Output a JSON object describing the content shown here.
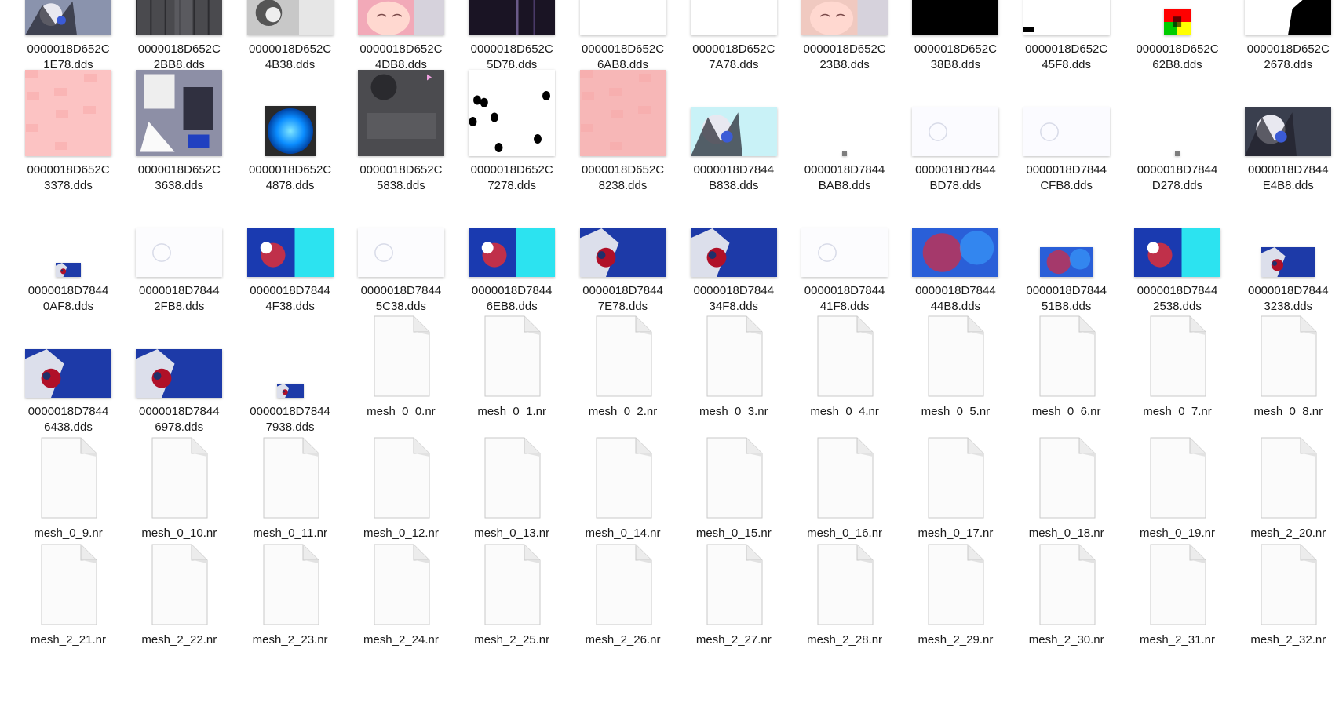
{
  "window_title": "",
  "files": [
    {
      "name": "0000018D652C\n1E78.dds",
      "kind": "image",
      "icon": "thumbnail-character-render",
      "thumb": {
        "w": 110,
        "h": 48,
        "bg": "#8a93ad",
        "pattern": "tex-char-dark"
      }
    },
    {
      "name": "0000018D652C\n2BB8.dds",
      "kind": "image",
      "icon": "thumbnail-dark-cloth-texture",
      "thumb": {
        "w": 110,
        "h": 48,
        "bg": "#4a4a4e",
        "pattern": "tex-dark-folds"
      }
    },
    {
      "name": "0000018D652C\n4B38.dds",
      "kind": "image",
      "icon": "thumbnail-grey-detail-texture",
      "thumb": {
        "w": 110,
        "h": 48,
        "bg": "#c8c8c8",
        "pattern": "tex-grey-detail"
      }
    },
    {
      "name": "0000018D652C\n4DB8.dds",
      "kind": "image",
      "icon": "thumbnail-pink-face-texture",
      "thumb": {
        "w": 110,
        "h": 48,
        "bg": "#f2a9b8",
        "pattern": "tex-face"
      }
    },
    {
      "name": "0000018D652C\n5D78.dds",
      "kind": "image",
      "icon": "thumbnail-dark-purple-texture",
      "thumb": {
        "w": 110,
        "h": 48,
        "bg": "#1a1424",
        "pattern": "tex-dark-purple"
      }
    },
    {
      "name": "0000018D652C\n6AB8.dds",
      "kind": "image",
      "icon": "thumbnail-blank-white",
      "thumb": {
        "w": 110,
        "h": 48,
        "bg": "#ffffff",
        "pattern": "none"
      }
    },
    {
      "name": "0000018D652C\n7A78.dds",
      "kind": "image",
      "icon": "thumbnail-blank-white",
      "thumb": {
        "w": 110,
        "h": 48,
        "bg": "#ffffff",
        "pattern": "none"
      }
    },
    {
      "name": "0000018D652C\n23B8.dds",
      "kind": "image",
      "icon": "thumbnail-chibi-face",
      "thumb": {
        "w": 110,
        "h": 48,
        "bg": "#f0c9c0",
        "pattern": "tex-face"
      }
    },
    {
      "name": "0000018D652C\n38B8.dds",
      "kind": "image",
      "icon": "thumbnail-black",
      "thumb": {
        "w": 110,
        "h": 48,
        "bg": "#000000",
        "pattern": "none"
      }
    },
    {
      "name": "0000018D652C\n45F8.dds",
      "kind": "image",
      "icon": "thumbnail-white-with-mark",
      "thumb": {
        "w": 110,
        "h": 48,
        "bg": "#ffffff",
        "pattern": "tex-corner-mark"
      }
    },
    {
      "name": "0000018D652C\n62B8.dds",
      "kind": "image",
      "icon": "thumbnail-rgb-gradient",
      "thumb": {
        "w": 34,
        "h": 34,
        "bg": "#000000",
        "pattern": "tex-rgb"
      }
    },
    {
      "name": "0000018D652C\n2678.dds",
      "kind": "image",
      "icon": "thumbnail-black-silhouette",
      "thumb": {
        "w": 110,
        "h": 48,
        "bg": "#ffffff",
        "pattern": "tex-silhouette"
      }
    },
    {
      "name": "0000018D652C\n3378.dds",
      "kind": "image",
      "icon": "thumbnail-pink-texture",
      "thumb": {
        "w": 110,
        "h": 110,
        "bg": "#fcc3c3",
        "pattern": "tex-pink-emboss"
      }
    },
    {
      "name": "0000018D652C\n3638.dds",
      "kind": "image",
      "icon": "thumbnail-armor-texture",
      "thumb": {
        "w": 110,
        "h": 110,
        "bg": "#8d8fa6",
        "pattern": "tex-armor"
      }
    },
    {
      "name": "0000018D652C\n4878.dds",
      "kind": "image",
      "icon": "thumbnail-blue-sphere",
      "thumb": {
        "w": 64,
        "h": 64,
        "bg": "#2a2a2a",
        "pattern": "tex-sphere"
      }
    },
    {
      "name": "0000018D652C\n5838.dds",
      "kind": "image",
      "icon": "thumbnail-dark-grey-texture",
      "thumb": {
        "w": 110,
        "h": 110,
        "bg": "#4b4b4f",
        "pattern": "tex-dark-grey"
      }
    },
    {
      "name": "0000018D652C\n7278.dds",
      "kind": "image",
      "icon": "thumbnail-white-black-spots",
      "thumb": {
        "w": 110,
        "h": 110,
        "bg": "#ffffff",
        "pattern": "tex-spots"
      }
    },
    {
      "name": "0000018D652C\n8238.dds",
      "kind": "image",
      "icon": "thumbnail-pink-emboss",
      "thumb": {
        "w": 110,
        "h": 110,
        "bg": "#f7b7b7",
        "pattern": "tex-pink-emboss"
      }
    },
    {
      "name": "0000018D7844\nB838.dds",
      "kind": "image",
      "icon": "thumbnail-character-on-cyan",
      "thumb": {
        "w": 110,
        "h": 62,
        "bg": "#c9f2f7",
        "pattern": "tex-char-dark"
      }
    },
    {
      "name": "0000018D7844\nBAB8.dds",
      "kind": "image",
      "icon": "thumbnail-tiny-dot",
      "thumb": {
        "w": 6,
        "h": 6,
        "bg": "#7d7d7d",
        "pattern": "none"
      }
    },
    {
      "name": "0000018D7844\nBD78.dds",
      "kind": "image",
      "icon": "thumbnail-faint-white",
      "thumb": {
        "w": 110,
        "h": 62,
        "bg": "#fbfbff",
        "pattern": "tex-faint"
      }
    },
    {
      "name": "0000018D7844\nCFB8.dds",
      "kind": "image",
      "icon": "thumbnail-faint-white",
      "thumb": {
        "w": 110,
        "h": 62,
        "bg": "#fbfbff",
        "pattern": "tex-faint"
      }
    },
    {
      "name": "0000018D7844\nD278.dds",
      "kind": "image",
      "icon": "thumbnail-tiny-dot",
      "thumb": {
        "w": 6,
        "h": 6,
        "bg": "#7d7d7d",
        "pattern": "none"
      }
    },
    {
      "name": "0000018D7844\nE4B8.dds",
      "kind": "image",
      "icon": "thumbnail-character-on-dark",
      "thumb": {
        "w": 110,
        "h": 62,
        "bg": "#3a3f4e",
        "pattern": "tex-char-dark"
      }
    },
    {
      "name": "0000018D7844\n0AF8.dds",
      "kind": "image",
      "icon": "thumbnail-small-blue",
      "thumb": {
        "w": 32,
        "h": 18,
        "bg": "#1d3aa8",
        "pattern": "tex-blue-char"
      }
    },
    {
      "name": "0000018D7844\n2FB8.dds",
      "kind": "image",
      "icon": "thumbnail-faint-white",
      "thumb": {
        "w": 110,
        "h": 62,
        "bg": "#fcfcfe",
        "pattern": "tex-faint"
      }
    },
    {
      "name": "0000018D7844\n4F38.dds",
      "kind": "image",
      "icon": "thumbnail-cyan-blue-blur",
      "thumb": {
        "w": 110,
        "h": 62,
        "bg": "#2ce3f0",
        "pattern": "tex-cyan-blue"
      }
    },
    {
      "name": "0000018D7844\n5C38.dds",
      "kind": "image",
      "icon": "thumbnail-faint-white",
      "thumb": {
        "w": 110,
        "h": 62,
        "bg": "#fcfcfe",
        "pattern": "tex-faint"
      }
    },
    {
      "name": "0000018D7844\n6EB8.dds",
      "kind": "image",
      "icon": "thumbnail-cyan-blue-blur",
      "thumb": {
        "w": 110,
        "h": 62,
        "bg": "#2ce3f0",
        "pattern": "tex-cyan-blue"
      }
    },
    {
      "name": "0000018D7844\n7E78.dds",
      "kind": "image",
      "icon": "thumbnail-blue-character",
      "thumb": {
        "w": 110,
        "h": 62,
        "bg": "#1d3aa8",
        "pattern": "tex-blue-char"
      }
    },
    {
      "name": "0000018D7844\n34F8.dds",
      "kind": "image",
      "icon": "thumbnail-blue-character",
      "thumb": {
        "w": 110,
        "h": 62,
        "bg": "#1d3aa8",
        "pattern": "tex-blue-char"
      }
    },
    {
      "name": "0000018D7844\n41F8.dds",
      "kind": "image",
      "icon": "thumbnail-faint-white",
      "thumb": {
        "w": 110,
        "h": 62,
        "bg": "#fcfcfe",
        "pattern": "tex-faint"
      }
    },
    {
      "name": "0000018D7844\n44B8.dds",
      "kind": "image",
      "icon": "thumbnail-blue-blur",
      "thumb": {
        "w": 110,
        "h": 62,
        "bg": "#2a5fd8",
        "pattern": "tex-blue-blur"
      }
    },
    {
      "name": "0000018D7844\n51B8.dds",
      "kind": "image",
      "icon": "thumbnail-blue-blur",
      "thumb": {
        "w": 68,
        "h": 38,
        "bg": "#2a5fd8",
        "pattern": "tex-blue-blur"
      }
    },
    {
      "name": "0000018D7844\n2538.dds",
      "kind": "image",
      "icon": "thumbnail-cyan-blue-blur",
      "thumb": {
        "w": 110,
        "h": 62,
        "bg": "#2ce3f0",
        "pattern": "tex-cyan-blue"
      }
    },
    {
      "name": "0000018D7844\n3238.dds",
      "kind": "image",
      "icon": "thumbnail-blue-character",
      "thumb": {
        "w": 68,
        "h": 38,
        "bg": "#1d3aa8",
        "pattern": "tex-blue-char"
      }
    },
    {
      "name": "0000018D7844\n6438.dds",
      "kind": "image",
      "icon": "thumbnail-blue-character",
      "thumb": {
        "w": 110,
        "h": 62,
        "bg": "#1d3aa8",
        "pattern": "tex-blue-char"
      }
    },
    {
      "name": "0000018D7844\n6978.dds",
      "kind": "image",
      "icon": "thumbnail-blue-character",
      "thumb": {
        "w": 110,
        "h": 62,
        "bg": "#1d3aa8",
        "pattern": "tex-blue-char"
      }
    },
    {
      "name": "0000018D7844\n7938.dds",
      "kind": "image",
      "icon": "thumbnail-blue-character",
      "thumb": {
        "w": 34,
        "h": 18,
        "bg": "#1d3aa8",
        "pattern": "tex-blue-char"
      }
    },
    {
      "name": "mesh_0_0.nr",
      "kind": "file",
      "icon": "blank-file-icon"
    },
    {
      "name": "mesh_0_1.nr",
      "kind": "file",
      "icon": "blank-file-icon"
    },
    {
      "name": "mesh_0_2.nr",
      "kind": "file",
      "icon": "blank-file-icon"
    },
    {
      "name": "mesh_0_3.nr",
      "kind": "file",
      "icon": "blank-file-icon"
    },
    {
      "name": "mesh_0_4.nr",
      "kind": "file",
      "icon": "blank-file-icon"
    },
    {
      "name": "mesh_0_5.nr",
      "kind": "file",
      "icon": "blank-file-icon"
    },
    {
      "name": "mesh_0_6.nr",
      "kind": "file",
      "icon": "blank-file-icon"
    },
    {
      "name": "mesh_0_7.nr",
      "kind": "file",
      "icon": "blank-file-icon"
    },
    {
      "name": "mesh_0_8.nr",
      "kind": "file",
      "icon": "blank-file-icon"
    },
    {
      "name": "mesh_0_9.nr",
      "kind": "file",
      "icon": "blank-file-icon"
    },
    {
      "name": "mesh_0_10.nr",
      "kind": "file",
      "icon": "blank-file-icon"
    },
    {
      "name": "mesh_0_11.nr",
      "kind": "file",
      "icon": "blank-file-icon"
    },
    {
      "name": "mesh_0_12.nr",
      "kind": "file",
      "icon": "blank-file-icon"
    },
    {
      "name": "mesh_0_13.nr",
      "kind": "file",
      "icon": "blank-file-icon"
    },
    {
      "name": "mesh_0_14.nr",
      "kind": "file",
      "icon": "blank-file-icon"
    },
    {
      "name": "mesh_0_15.nr",
      "kind": "file",
      "icon": "blank-file-icon"
    },
    {
      "name": "mesh_0_16.nr",
      "kind": "file",
      "icon": "blank-file-icon"
    },
    {
      "name": "mesh_0_17.nr",
      "kind": "file",
      "icon": "blank-file-icon"
    },
    {
      "name": "mesh_0_18.nr",
      "kind": "file",
      "icon": "blank-file-icon"
    },
    {
      "name": "mesh_0_19.nr",
      "kind": "file",
      "icon": "blank-file-icon"
    },
    {
      "name": "mesh_2_20.nr",
      "kind": "file",
      "icon": "blank-file-icon"
    },
    {
      "name": "mesh_2_21.nr",
      "kind": "file",
      "icon": "blank-file-icon"
    },
    {
      "name": "mesh_2_22.nr",
      "kind": "file",
      "icon": "blank-file-icon"
    },
    {
      "name": "mesh_2_23.nr",
      "kind": "file",
      "icon": "blank-file-icon"
    },
    {
      "name": "mesh_2_24.nr",
      "kind": "file",
      "icon": "blank-file-icon"
    },
    {
      "name": "mesh_2_25.nr",
      "kind": "file",
      "icon": "blank-file-icon"
    },
    {
      "name": "mesh_2_26.nr",
      "kind": "file",
      "icon": "blank-file-icon"
    },
    {
      "name": "mesh_2_27.nr",
      "kind": "file",
      "icon": "blank-file-icon"
    },
    {
      "name": "mesh_2_28.nr",
      "kind": "file",
      "icon": "blank-file-icon"
    },
    {
      "name": "mesh_2_29.nr",
      "kind": "file",
      "icon": "blank-file-icon"
    },
    {
      "name": "mesh_2_30.nr",
      "kind": "file",
      "icon": "blank-file-icon"
    },
    {
      "name": "mesh_2_31.nr",
      "kind": "file",
      "icon": "blank-file-icon"
    },
    {
      "name": "mesh_2_32.nr",
      "kind": "file",
      "icon": "blank-file-icon"
    }
  ]
}
